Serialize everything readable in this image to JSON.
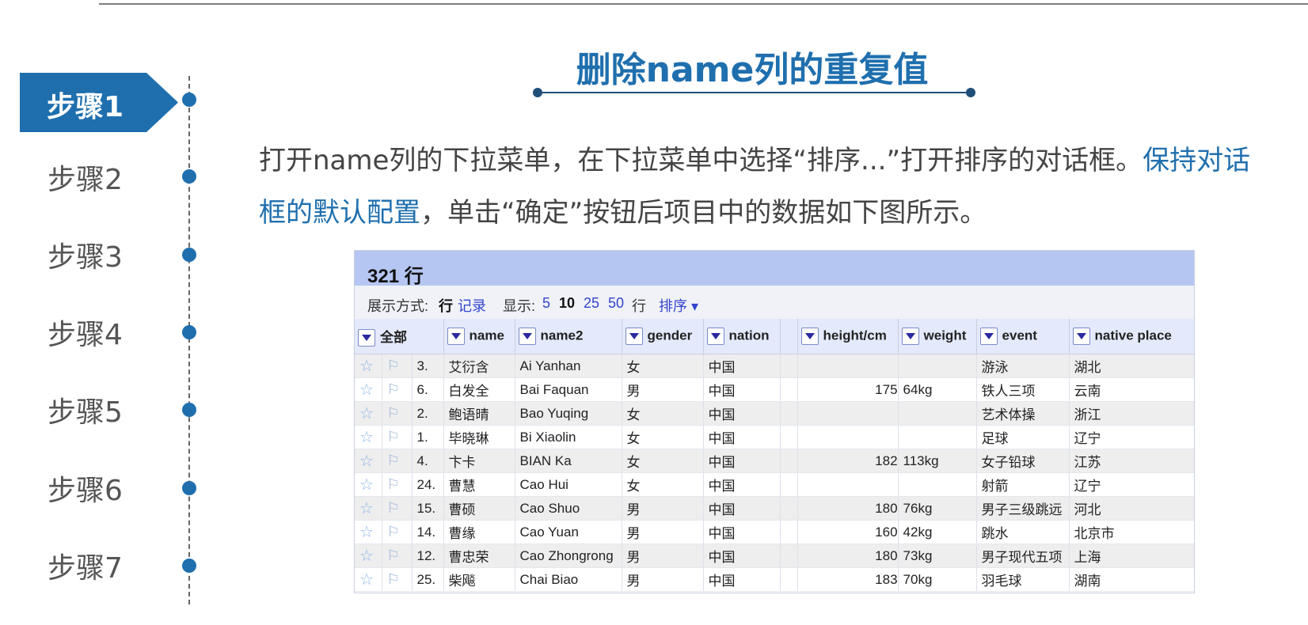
{
  "sidebar": {
    "steps": [
      "步骤1",
      "步骤2",
      "步骤3",
      "步骤4",
      "步骤5",
      "步骤6",
      "步骤7"
    ]
  },
  "header": {
    "title": "删除name列的重复值"
  },
  "instruction": {
    "part1": "打开name列的下拉菜单，在下拉菜单中选择“排序...”打开排序的对话框。",
    "highlight": "保持对话框的默认配置",
    "part2": "，单击“确定”按钮后项目中的数据如下图所示。"
  },
  "panel": {
    "row_count": "321 行",
    "view_label": "展示方式:",
    "view_rows": "行",
    "view_records": "记录",
    "show_label": "显示:",
    "page_sizes": [
      "5",
      "10",
      "25",
      "50"
    ],
    "rows_unit": "行",
    "sort_label": "排序 ▾"
  },
  "table": {
    "columns": [
      "全部",
      "name",
      "name2",
      "gender",
      "nation",
      "",
      "height/cm",
      "weight",
      "event",
      "native place"
    ],
    "rows": [
      [
        "3.",
        "艾衍含",
        "Ai Yanhan",
        "女",
        "中国",
        "",
        "",
        "",
        "游泳",
        "湖北"
      ],
      [
        "6.",
        "白发全",
        "Bai Faquan",
        "男",
        "中国",
        "",
        "175",
        "64kg",
        "铁人三项",
        "云南"
      ],
      [
        "2.",
        "鲍语晴",
        "Bao Yuqing",
        "女",
        "中国",
        "",
        "",
        "",
        "艺术体操",
        "浙江"
      ],
      [
        "1.",
        "毕晓琳",
        "Bi Xiaolin",
        "女",
        "中国",
        "",
        "",
        "",
        "足球",
        "辽宁"
      ],
      [
        "4.",
        "卞卡",
        "BIAN Ka",
        "女",
        "中国",
        "",
        "182",
        "113kg",
        "女子铅球",
        "江苏"
      ],
      [
        "24.",
        "曹慧",
        "Cao Hui",
        "女",
        "中国",
        "",
        "",
        "",
        "射箭",
        "辽宁"
      ],
      [
        "15.",
        "曹硕",
        "Cao Shuo",
        "男",
        "中国",
        "",
        "180",
        "76kg",
        "男子三级跳远",
        "河北"
      ],
      [
        "14.",
        "曹缘",
        "Cao Yuan",
        "男",
        "中国",
        "",
        "160",
        "42kg",
        "跳水",
        "北京市"
      ],
      [
        "12.",
        "曹忠荣",
        "Cao Zhongrong",
        "男",
        "中国",
        "",
        "180",
        "73kg",
        "男子现代五项",
        "上海"
      ],
      [
        "25.",
        "柴飚",
        "Chai Biao",
        "男",
        "中国",
        "",
        "183",
        "70kg",
        "羽毛球",
        "湖南"
      ]
    ]
  }
}
